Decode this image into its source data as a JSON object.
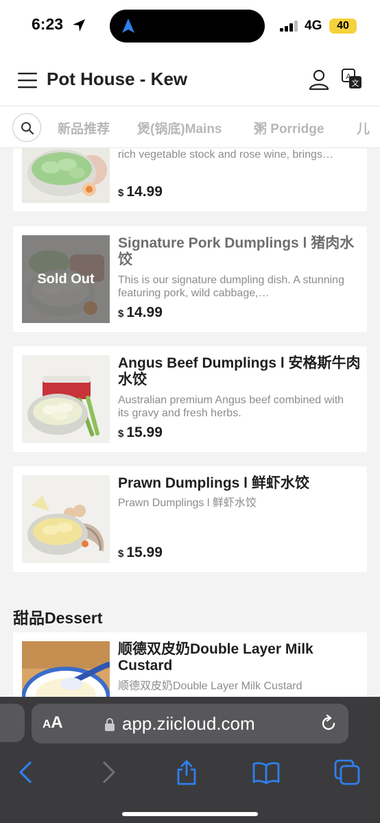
{
  "status": {
    "time": "6:23",
    "network": "4G",
    "battery": "40"
  },
  "header": {
    "title": "Pot House - Kew"
  },
  "categories": [
    "新品推荐",
    "煲(锅底)Mains",
    "粥 Porridge",
    "儿"
  ],
  "items": [
    {
      "desc": "rich vegetable stock and rose wine, brings…",
      "currency": "$",
      "price": "14.99"
    },
    {
      "name": "Signature Pork Dumplings l 猪肉水饺",
      "desc": "This is our signature dumpling dish. A stunning featuring pork, wild cabbage,…",
      "currency": "$",
      "price": "14.99",
      "sold_out_label": "Sold Out"
    },
    {
      "name": "Angus Beef Dumplings l 安格斯牛肉水饺",
      "desc": "Australian premium Angus beef combined with its gravy and fresh herbs.",
      "currency": "$",
      "price": "15.99"
    },
    {
      "name": "Prawn Dumplings l 鲜虾水饺",
      "desc": "Prawn Dumplings l 鲜虾水饺",
      "currency": "$",
      "price": "15.99"
    }
  ],
  "dessert": {
    "section_title": "甜品Dessert",
    "name": "顺德双皮奶Double Layer Milk Custard",
    "desc": "顺德双皮奶Double Layer Milk Custard"
  },
  "browser": {
    "aa_small": "A",
    "aa_big": "A",
    "url": "app.ziicloud.com"
  },
  "colors": {
    "accent": "#2f80ed",
    "sold_out_overlay": "#5a5a5a",
    "battery": "#f5d23c"
  }
}
